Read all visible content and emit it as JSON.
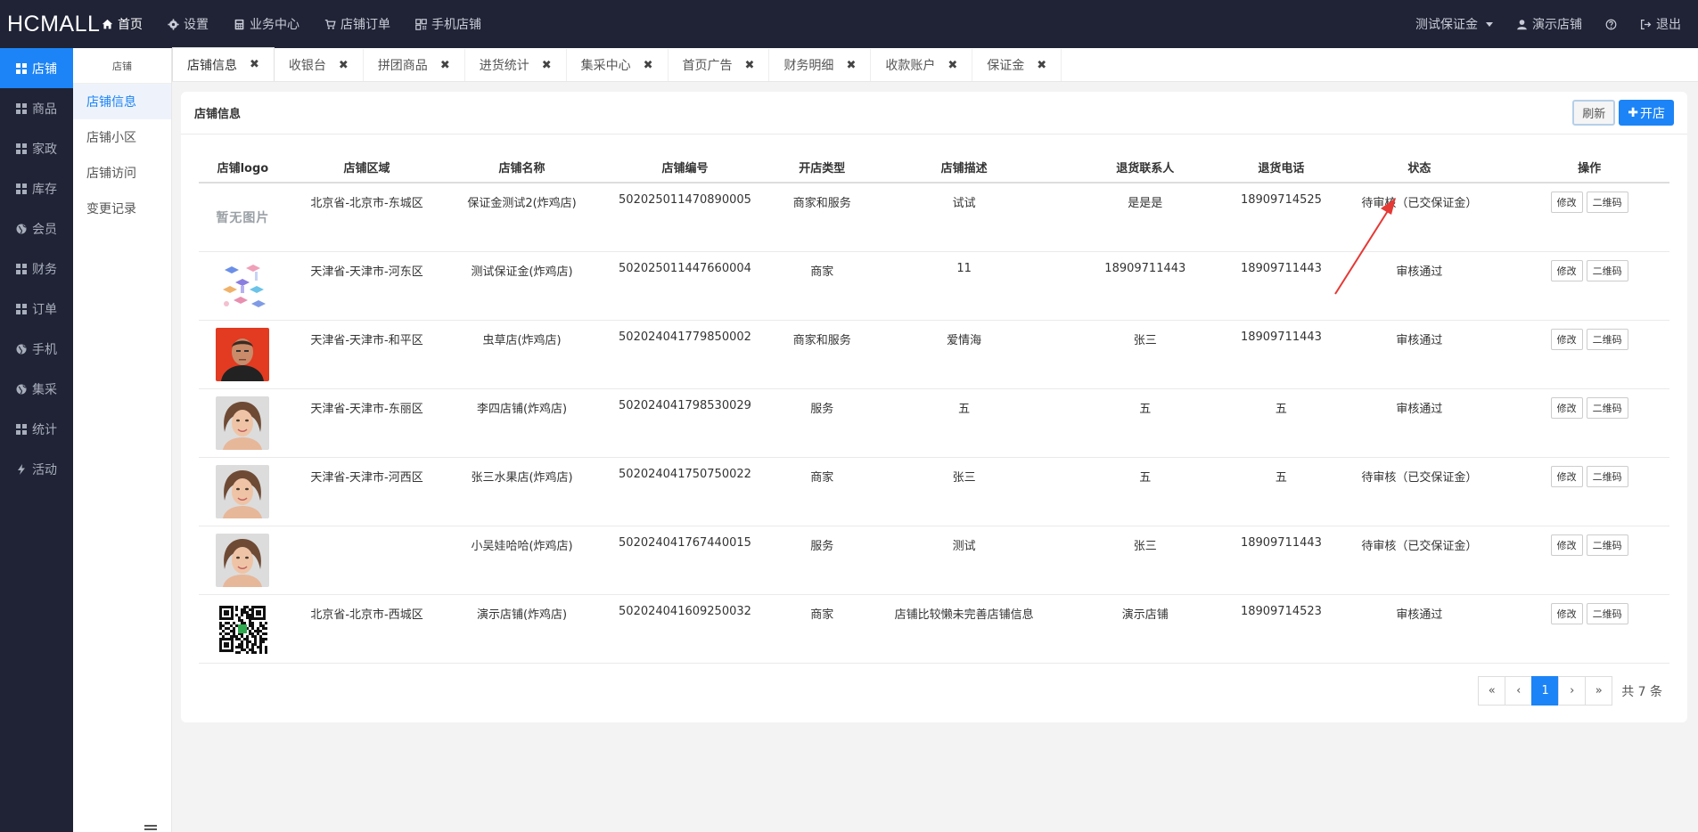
{
  "app": {
    "logo": "HCMALL"
  },
  "topnav": [
    {
      "icon": "home-icon",
      "label": "首页",
      "active": true
    },
    {
      "icon": "gear-icon",
      "label": "设置"
    },
    {
      "icon": "calculator-icon",
      "label": "业务中心"
    },
    {
      "icon": "cart-icon",
      "label": "店铺订单"
    },
    {
      "icon": "qrcode-icon",
      "label": "手机店铺"
    }
  ],
  "topright": {
    "account": "测试保证金",
    "shop": "演示店铺",
    "logout": "退出"
  },
  "sidebar": [
    {
      "icon": "grid-icon",
      "label": "店铺",
      "active": true
    },
    {
      "icon": "grid-icon",
      "label": "商品"
    },
    {
      "icon": "grid-icon",
      "label": "家政"
    },
    {
      "icon": "grid-icon",
      "label": "库存"
    },
    {
      "icon": "globe-icon",
      "label": "会员"
    },
    {
      "icon": "grid-icon",
      "label": "财务"
    },
    {
      "icon": "grid-icon",
      "label": "订单"
    },
    {
      "icon": "globe-icon",
      "label": "手机"
    },
    {
      "icon": "globe-icon",
      "label": "集采"
    },
    {
      "icon": "grid-icon",
      "label": "统计"
    },
    {
      "icon": "bolt-icon",
      "label": "活动"
    }
  ],
  "subside": {
    "title": "店铺",
    "items": [
      "店铺信息",
      "店铺小区",
      "店铺访问",
      "变更记录"
    ]
  },
  "tabs": [
    "店铺信息",
    "收银台",
    "拼团商品",
    "进货统计",
    "集采中心",
    "首页广告",
    "财务明细",
    "收款账户",
    "保证金"
  ],
  "panel": {
    "title": "店铺信息",
    "refresh": "刷新",
    "open": "开店"
  },
  "table": {
    "headers": [
      "店铺logo",
      "店铺区域",
      "店铺名称",
      "店铺编号",
      "开店类型",
      "店铺描述",
      "退货联系人",
      "退货电话",
      "状态",
      "操作"
    ],
    "edit_label": "修改",
    "qr_label": "二维码",
    "no_image_text": "暂无图片",
    "rows": [
      {
        "logo": "none",
        "region": "北京省-北京市-东城区",
        "name": "保证金测试2(炸鸡店)",
        "code": "502025011470890005",
        "type": "商家和服务",
        "desc": "试试",
        "contact": "是是是",
        "phone": "18909714525",
        "status": "待审核（已交保证金）"
      },
      {
        "logo": "isometric",
        "region": "天津省-天津市-河东区",
        "name": "测试保证金(炸鸡店)",
        "code": "502025011447660004",
        "type": "商家",
        "desc": "11",
        "contact": "18909711443",
        "phone": "18909711443",
        "status": "审核通过"
      },
      {
        "logo": "portrait-red",
        "region": "天津省-天津市-和平区",
        "name": "虫草店(炸鸡店)",
        "code": "502024041779850002",
        "type": "商家和服务",
        "desc": "爱情海",
        "contact": "张三",
        "phone": "18909711443",
        "status": "审核通过"
      },
      {
        "logo": "portrait-woman",
        "region": "天津省-天津市-东丽区",
        "name": "李四店铺(炸鸡店)",
        "code": "502024041798530029",
        "type": "服务",
        "desc": "五",
        "contact": "五",
        "phone": "五",
        "status": "审核通过"
      },
      {
        "logo": "portrait-woman",
        "region": "天津省-天津市-河西区",
        "name": "张三水果店(炸鸡店)",
        "code": "502024041750750022",
        "type": "商家",
        "desc": "张三",
        "contact": "五",
        "phone": "五",
        "status": "待审核（已交保证金）"
      },
      {
        "logo": "portrait-woman",
        "region": "",
        "name": "小吴娃哈哈(炸鸡店)",
        "code": "502024041767440015",
        "type": "服务",
        "desc": "测试",
        "contact": "张三",
        "phone": "18909711443",
        "status": "待审核（已交保证金）"
      },
      {
        "logo": "qrcode",
        "region": "北京省-北京市-西城区",
        "name": "演示店铺(炸鸡店)",
        "code": "502024041609250032",
        "type": "商家",
        "desc": "店铺比较懒未完善店铺信息",
        "contact": "演示店铺",
        "phone": "18909714523",
        "status": "审核通过"
      }
    ]
  },
  "pagination": {
    "first": "«",
    "prev": "‹",
    "current": "1",
    "next": "›",
    "last": "»",
    "total": "共 7 条"
  },
  "colors": {
    "topbar": "#1f2335",
    "accent": "#1c84f6",
    "annotation_arrow": "#e53935"
  }
}
